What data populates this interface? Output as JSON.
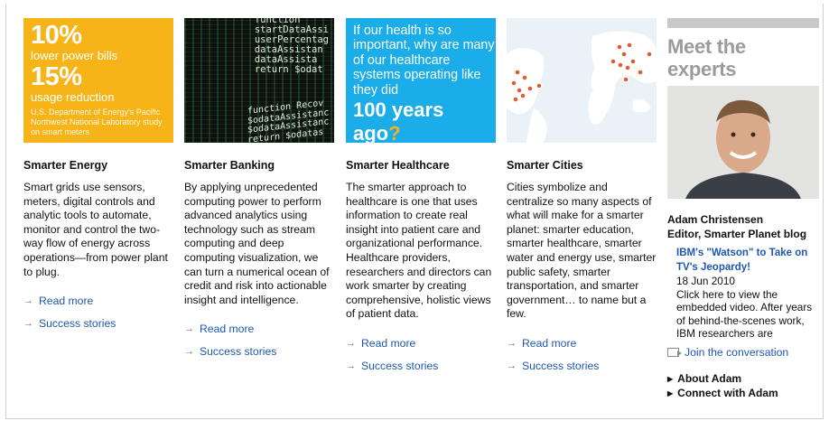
{
  "cards": [
    {
      "title": "Smarter Energy",
      "description": "Smart grids use sensors, meters, digital controls and analytic tools to automate, monitor and control the two-way flow of energy across operations—from power plant to plug.",
      "read_more": "Read more",
      "success_stories": "Success stories",
      "image": {
        "line1": "10%",
        "line2": "lower power bills",
        "line3": "15%",
        "line4": "usage reduction",
        "line5": "U.S. Department of Energy's Pacific Northwest National Laboratory study on smart meters",
        "color": "#f6b419"
      }
    },
    {
      "title": "Smarter Banking",
      "description": "By applying unprecedented computing power to perform advanced analytics using technology such as stream computing and deep computing visualization, we can turn a numerical ocean of credit and risk into actionable insight and intelligence.",
      "read_more": "Read more",
      "success_stories": "Success stories",
      "image": {
        "code_top": "function\nstartDataAssi\nuserPercentag\ndataAssistan\ndataAssista\nreturn $odat",
        "code_bottom": "function Recov\n$odataAssistanc\n$odataAssistanc\nreturn $odatas"
      }
    },
    {
      "title": "Smarter Healthcare",
      "description": "The smarter approach to healthcare is one that uses information to create real insight into patient care and organizational performance. Healthcare providers, researchers and directors can work smarter by creating comprehensive, holistic views of patient data.",
      "read_more": "Read more",
      "success_stories": "Success stories",
      "image": {
        "question": "If our health is so important, why are many of our healthcare systems operating like they did",
        "emphasis_main": "100 years ago",
        "emphasis_mark": "?",
        "color": "#1badea"
      }
    },
    {
      "title": "Smarter Cities",
      "description": "Cities symbolize and centralize so many aspects of what will make for a smarter planet: smarter education, smarter healthcare, smarter water and energy use, smarter public safety, smarter transportation, and smarter government… to name but a few.",
      "read_more": "Read more",
      "success_stories": "Success stories"
    }
  ],
  "experts": {
    "heading": "Meet the experts",
    "name": "Adam Christensen",
    "role": "Editor, Smarter Planet blog",
    "post_title": "IBM's \"Watson\" to Take on TV's Jeopardy!",
    "post_date": "18 Jun 2010",
    "post_body": "Click here to view the embedded video. After years of behind-the-scenes work, IBM researchers are",
    "join": "Join the conversation",
    "about": "About Adam",
    "connect": "Connect with Adam"
  },
  "colors": {
    "link": "#1f57b0",
    "energy": "#f6b419",
    "healthcare": "#1badea"
  },
  "icons": [
    "arrow-right-icon",
    "chat-bubble-icon",
    "triangle-right-icon",
    "world-map-icon"
  ]
}
